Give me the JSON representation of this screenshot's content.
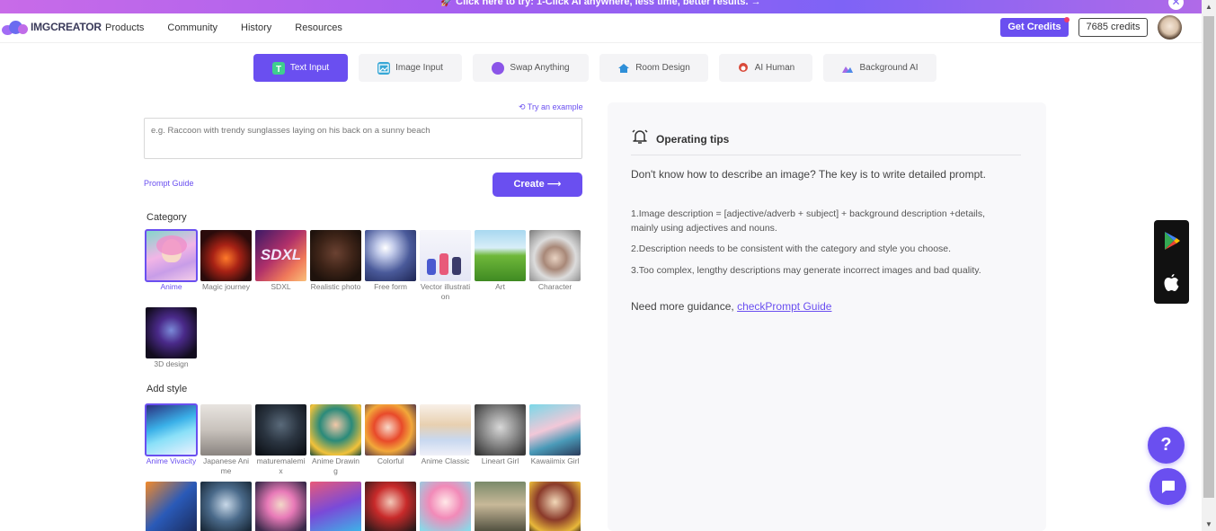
{
  "promo": {
    "text": "🚀 Click here to try: 1-Click AI anywhere, less time, better results. →"
  },
  "header": {
    "logo": "IMGCREATOR",
    "nav": [
      "Products",
      "Community",
      "History",
      "Resources"
    ],
    "get_credits": "Get Credits",
    "credits": "7685 credits"
  },
  "tabs": [
    {
      "label": "Text Input",
      "icon": "text-icon",
      "active": true
    },
    {
      "label": "Image Input",
      "icon": "image-icon",
      "active": false
    },
    {
      "label": "Swap Anything",
      "icon": "swap-icon",
      "active": false
    },
    {
      "label": "Room Design",
      "icon": "house-icon",
      "active": false
    },
    {
      "label": "AI Human",
      "icon": "human-icon",
      "active": false
    },
    {
      "label": "Background AI",
      "icon": "background-icon",
      "active": false
    }
  ],
  "prompt": {
    "try_example": "Try an example",
    "placeholder": "e.g. Raccoon with trendy sunglasses laying on his back on a sunny beach",
    "guide": "Prompt Guide",
    "create": "Create ⟶"
  },
  "category": {
    "title": "Category",
    "items": [
      {
        "label": "Anime",
        "selected": true
      },
      {
        "label": "Magic journey"
      },
      {
        "label": "SDXL"
      },
      {
        "label": "Realistic photo"
      },
      {
        "label": "Free form"
      },
      {
        "label": "Vector illustration"
      },
      {
        "label": "Art"
      },
      {
        "label": "Character"
      },
      {
        "label": "3D design"
      }
    ]
  },
  "style": {
    "title": "Add style",
    "items": [
      {
        "label": "Anime Vivacity",
        "selected": true
      },
      {
        "label": "Japanese Anime"
      },
      {
        "label": "maturemalemix"
      },
      {
        "label": "Anime Drawing"
      },
      {
        "label": "Colorful"
      },
      {
        "label": "Anime Classic"
      },
      {
        "label": "Lineart Girl"
      },
      {
        "label": "Kawaiimix Girl"
      },
      {
        "label": ""
      },
      {
        "label": ""
      },
      {
        "label": ""
      },
      {
        "label": ""
      },
      {
        "label": ""
      },
      {
        "label": ""
      },
      {
        "label": ""
      },
      {
        "label": ""
      }
    ]
  },
  "tips": {
    "title": "Operating tips",
    "intro": "Don't know how to describe an image? The key is to write detailed prompt.",
    "items": [
      "1.Image description = [adjective/adverb + subject] + background description +details, mainly using adjectives and nouns.",
      "2.Description needs to be consistent with the category and style you choose.",
      "3.Too complex, lengthy descriptions may generate incorrect images and bad quality."
    ],
    "more_prefix": "Need more guidance, ",
    "more_link": "checkPrompt Guide"
  },
  "fab": {
    "help": "?"
  },
  "colors": {
    "accent": "#6a4ff0"
  }
}
